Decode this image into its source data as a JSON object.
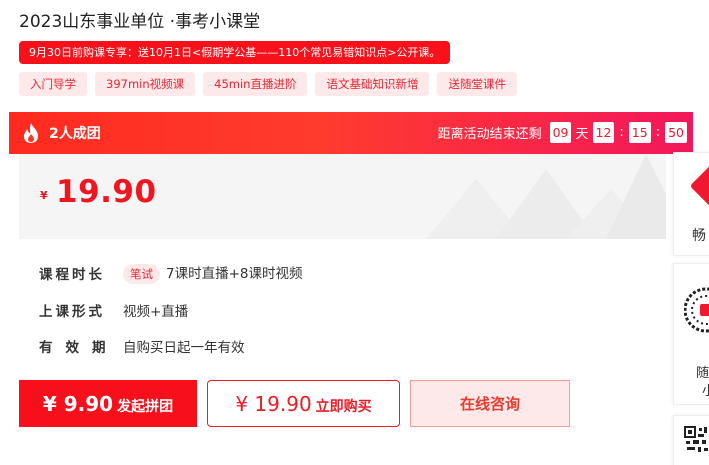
{
  "course": {
    "title": "2023山东事业单位 ·事考小课堂",
    "promo": "9月30日前购课专享：送10月1日<假期学公基——110个常见易错知识点>公开课。",
    "tags": [
      "入门导学",
      "397min视频课",
      "45min直播进阶",
      "语文基础知识新增",
      "送随堂课件"
    ]
  },
  "group_bar": {
    "label": "2人成团",
    "countdown_prefix": "距离活动结束还剩",
    "days": "09",
    "day_unit": "天",
    "hours": "12",
    "minutes": "15",
    "seconds": "50",
    "separator": ":"
  },
  "price": {
    "currency": "¥",
    "amount": "19.90"
  },
  "details": {
    "duration_label": "课程时长",
    "exam_badge": "笔试",
    "duration_value": "7课时直播+8课时视频",
    "format_label": "上课形式",
    "format_value": "视频+直播",
    "validity_label": "有效期",
    "validity_value": "自购买日起一年有效"
  },
  "buttons": {
    "group_price": "¥ 9.90",
    "group_action": "发起拼团",
    "buy_price": "¥ 19.90",
    "buy_action": "立即购买",
    "consult": "在线咨询"
  },
  "sidebar": {
    "card1_text": "畅",
    "card2_line1": "随",
    "card2_line2": "小"
  },
  "colors": {
    "accent_red": "#f0161f",
    "tag_bg": "#fde9ea"
  }
}
